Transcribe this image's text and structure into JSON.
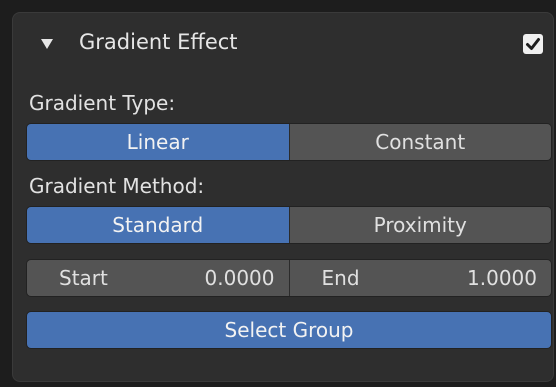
{
  "panel": {
    "title": "Gradient Effect",
    "enabled": true
  },
  "gradient_type": {
    "label": "Gradient Type:",
    "options": [
      "Linear",
      "Constant"
    ],
    "selected": "Linear"
  },
  "gradient_method": {
    "label": "Gradient Method:",
    "options": [
      "Standard",
      "Proximity"
    ],
    "selected": "Standard"
  },
  "range": {
    "start_label": "Start",
    "start_value": "0.0000",
    "end_label": "End",
    "end_value": "1.0000"
  },
  "actions": {
    "select_group": "Select Group"
  },
  "colors": {
    "accent": "#4772b3",
    "button": "#545454",
    "panel": "#2e2e2e"
  }
}
